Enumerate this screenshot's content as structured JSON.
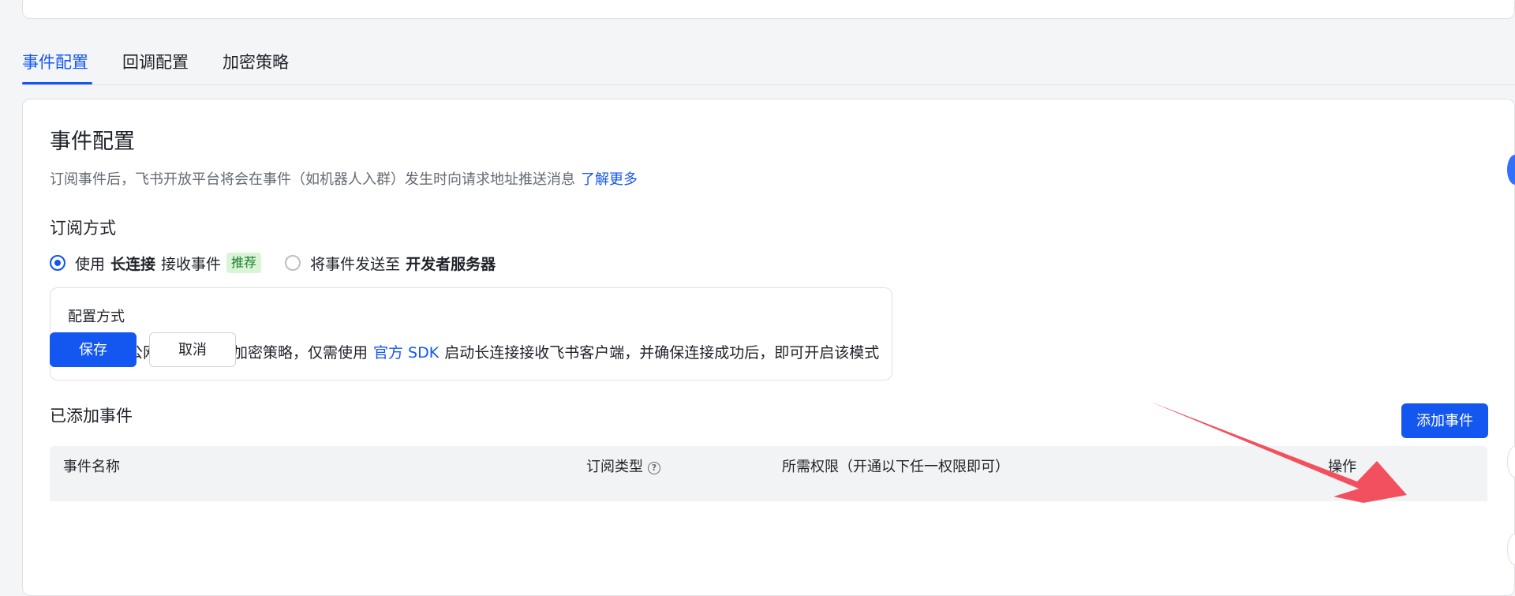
{
  "tabs": [
    {
      "label": "事件配置",
      "active": true
    },
    {
      "label": "回调配置",
      "active": false
    },
    {
      "label": "加密策略",
      "active": false
    }
  ],
  "event_config": {
    "title": "事件配置",
    "description": "订阅事件后，飞书开放平台将会在事件（如机器人入群）发生时向请求地址推送消息",
    "learn_more": "了解更多",
    "subscription_label": "订阅方式",
    "option_long_conn": {
      "prefix": "使用",
      "bold": "长连接",
      "suffix": "接收事件",
      "tag": "推荐",
      "selected": true
    },
    "option_dev_server": {
      "prefix": "将事件发送至",
      "bold": "开发者服务器",
      "selected": false
    },
    "config_box": {
      "title": "配置方式",
      "desc_before": "无需注册公网域名或配置加密策略，仅需使用",
      "desc_link": "官方 SDK",
      "desc_after": "启动长连接接收飞书客户端，并确保连接成功后，即可开启该模式"
    },
    "save_label": "保存",
    "cancel_label": "取消"
  },
  "added_events": {
    "title": "已添加事件",
    "add_button": "添加事件",
    "columns": [
      "事件名称",
      "订阅类型",
      "所需权限（开通以下任一权限即可）",
      "操作"
    ]
  },
  "colors": {
    "accent": "#1456f0",
    "tag_bg": "#d9f5d6",
    "tag_text": "#1c7f2f",
    "annotation_arrow": "#f2505f"
  },
  "icons": {
    "help": "question-circle-icon"
  }
}
